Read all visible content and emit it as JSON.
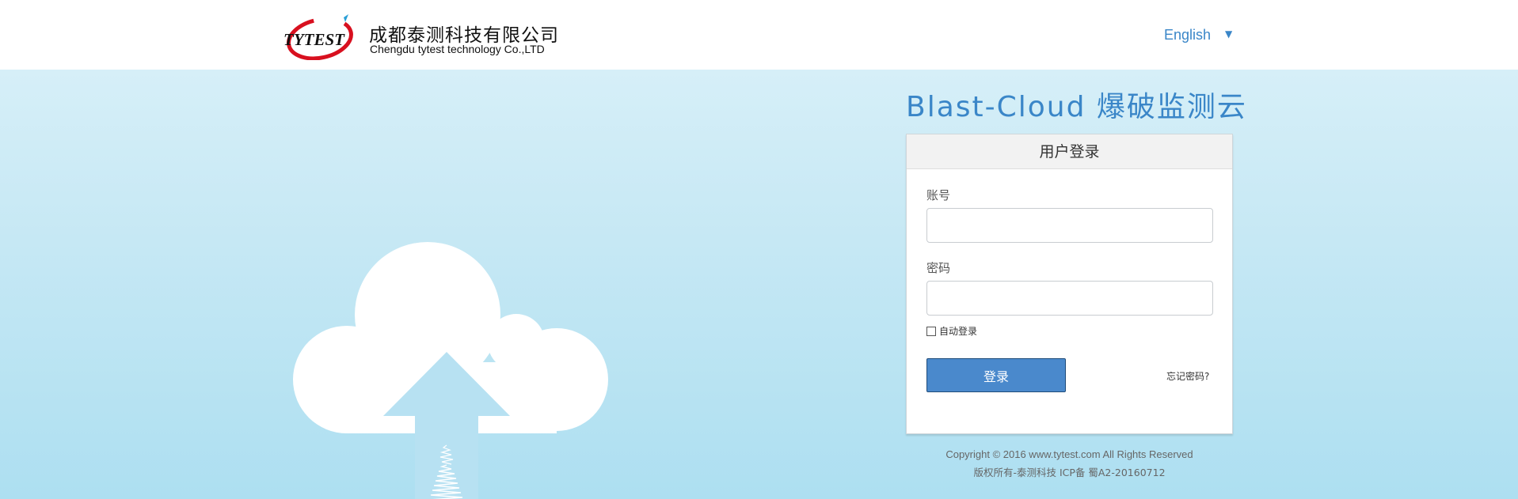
{
  "header": {
    "company_cn": "成都泰测科技有限公司",
    "company_en": "Chengdu tytest technology Co.,LTD",
    "logo_text": "TYTEST",
    "language": "English",
    "language_caret": "▼"
  },
  "main": {
    "app_title": "Blast-Cloud 爆破监测云"
  },
  "login": {
    "panel_title": "用户登录",
    "account_label": "账号",
    "account_value": "",
    "password_label": "密码",
    "password_value": "",
    "remember_label": "自动登录",
    "submit_label": "登录",
    "forgot_label": "忘记密码?"
  },
  "footer": {
    "copyright": "Copyright © 2016    www.tytest.com    All Rights Reserved",
    "icp": "版权所有-泰测科技    ICP备 蜀A2-20160712"
  },
  "colors": {
    "accent": "#3a86c8",
    "button": "#4a89cc",
    "background_top": "#d6eff8",
    "background_bottom": "#addff1",
    "logo_red": "#d8101f"
  },
  "icons": {
    "logo": "tytest-logo-icon",
    "illustration": "cloud-upload-icon"
  }
}
